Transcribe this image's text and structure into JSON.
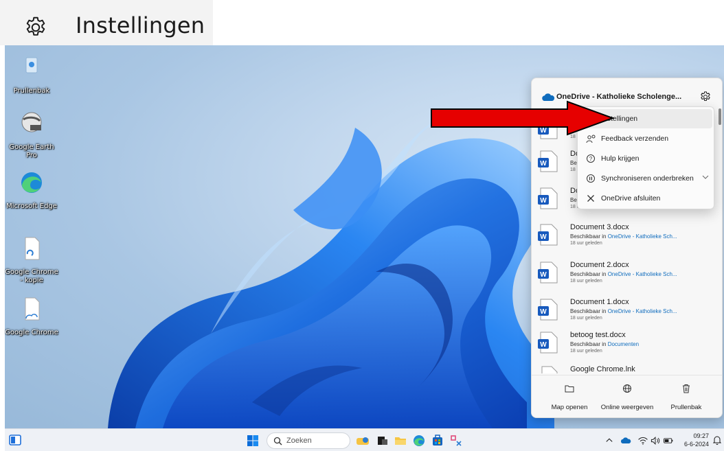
{
  "header": {
    "title": "Instellingen",
    "icon": "gear-icon"
  },
  "desktop_icons": [
    {
      "label": "Prullenbak",
      "icon": "recycle-bin-icon"
    },
    {
      "label": "Google Earth Pro",
      "icon": "google-earth-icon"
    },
    {
      "label": "Microsoft Edge",
      "icon": "edge-icon"
    },
    {
      "label": "Google Chrome - kopie",
      "icon": "file-shortcut-icon"
    },
    {
      "label": "Google Chrome",
      "icon": "file-shortcut-icon"
    }
  ],
  "onedrive": {
    "title": "OneDrive - Katholieke Scholenge...",
    "files": [
      {
        "name": "Do",
        "location_prefix": "Be",
        "location": "",
        "time": "18 u"
      },
      {
        "name": "Do",
        "location_prefix": "Be",
        "location": "",
        "time": "18 u"
      },
      {
        "name": "Do",
        "location_prefix": "Be",
        "location": "",
        "time": "18 u"
      },
      {
        "name": "Document 3.docx",
        "location_prefix": "Beschikbaar in ",
        "location": "OneDrive - Katholieke Sch...",
        "time": "18 uur geleden"
      },
      {
        "name": "Document 2.docx",
        "location_prefix": "Beschikbaar in ",
        "location": "OneDrive - Katholieke Sch...",
        "time": "18 uur geleden"
      },
      {
        "name": "Document 1.docx",
        "location_prefix": "Beschikbaar in ",
        "location": "OneDrive - Katholieke Sch...",
        "time": "18 uur geleden"
      },
      {
        "name": "betoog test.docx",
        "location_prefix": "Beschikbaar in ",
        "location": "Documenten",
        "time": "18 uur geleden"
      },
      {
        "name": "Google Chrome.lnk",
        "location_prefix": "",
        "location": "",
        "time": ""
      }
    ],
    "footer": {
      "open_folder": "Map openen",
      "view_online": "Online weergeven",
      "recycle_bin": "Prullenbak"
    }
  },
  "context_menu": {
    "items": [
      {
        "label": "Instellingen",
        "icon": "gear-icon"
      },
      {
        "label": "Feedback verzenden",
        "icon": "feedback-icon"
      },
      {
        "label": "Hulp krijgen",
        "icon": "help-icon"
      },
      {
        "label": "Synchroniseren onderbreken",
        "icon": "pause-icon"
      },
      {
        "label": "OneDrive afsluiten",
        "icon": "close-icon"
      }
    ]
  },
  "taskbar": {
    "search_placeholder": "Zoeken",
    "time": "09:27",
    "date": "6-6-2024"
  },
  "colors": {
    "accent": "#0f6cbd",
    "arrow": "#e60000",
    "word_blue": "#185abd"
  }
}
